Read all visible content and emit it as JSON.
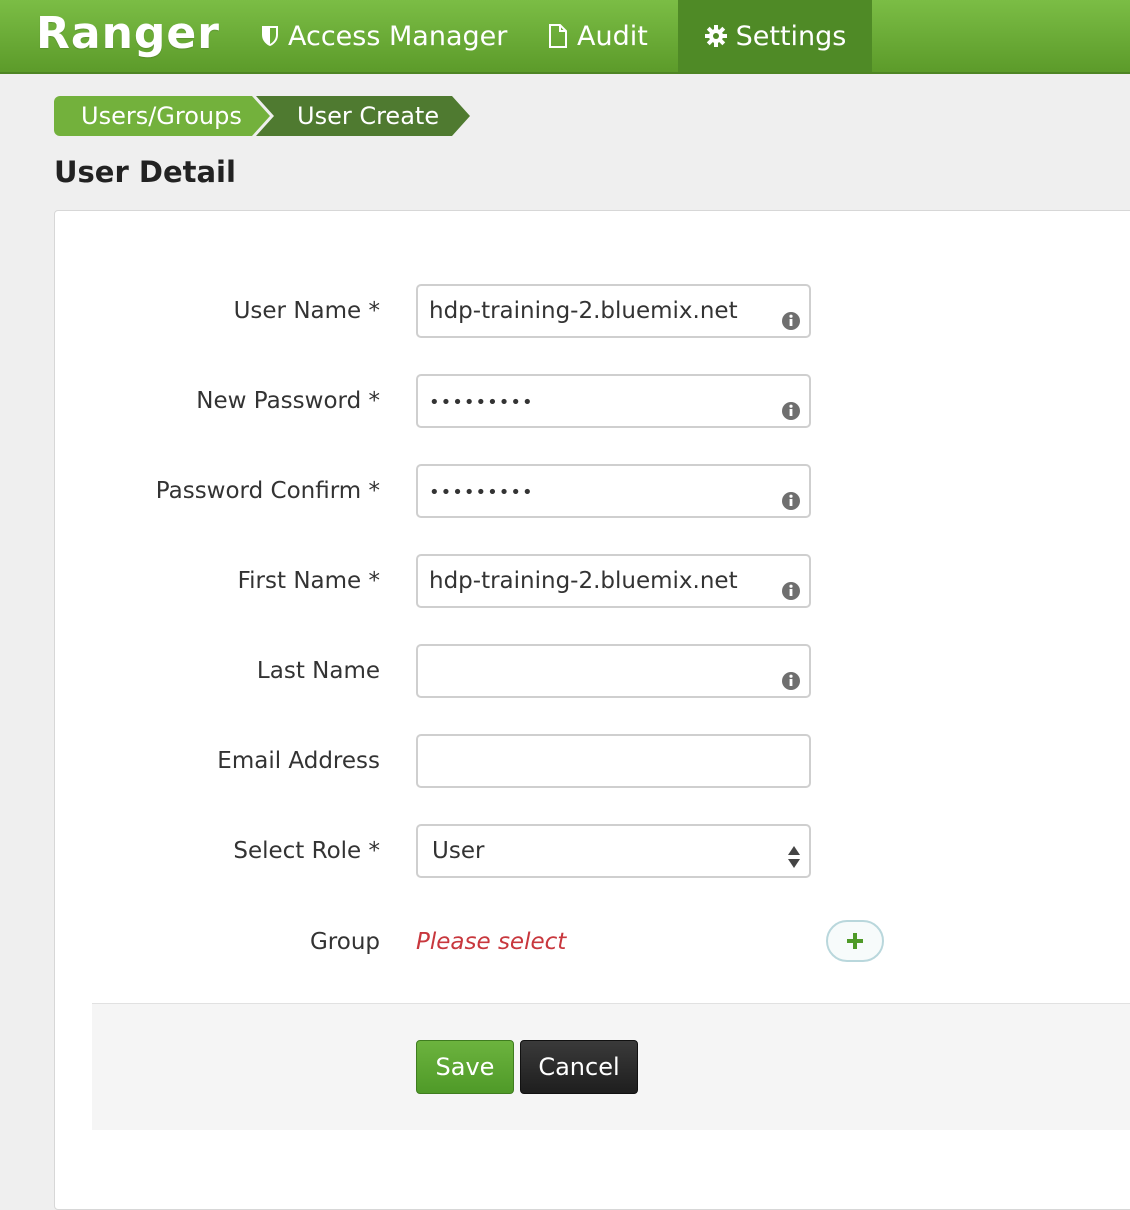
{
  "nav": {
    "brand": "Ranger",
    "items": [
      {
        "label": "Access Manager",
        "icon": "shield-icon"
      },
      {
        "label": "Audit",
        "icon": "file-icon"
      },
      {
        "label": "Settings",
        "icon": "gear-icon",
        "active": true
      }
    ]
  },
  "breadcrumb": [
    "Users/Groups",
    "User Create"
  ],
  "page": {
    "title": "User Detail"
  },
  "form": {
    "username": {
      "label": "User Name *",
      "value": "hdp-training-2.bluemix.net"
    },
    "new_password": {
      "label": "New Password *",
      "value": "•••••••••"
    },
    "password_confirm": {
      "label": "Password Confirm *",
      "value": "•••••••••"
    },
    "first_name": {
      "label": "First Name *",
      "value": "hdp-training-2.bluemix.net"
    },
    "last_name": {
      "label": "Last Name",
      "value": ""
    },
    "email": {
      "label": "Email Address",
      "value": ""
    },
    "role": {
      "label": "Select Role *",
      "value": "User"
    },
    "group": {
      "label": "Group",
      "placeholder": "Please select"
    }
  },
  "actions": {
    "save": "Save",
    "cancel": "Cancel"
  },
  "colors": {
    "navbar": "#6aad37",
    "active_tab": "#4f8a26",
    "save": "#5ea733",
    "error_text": "#c8373d"
  }
}
